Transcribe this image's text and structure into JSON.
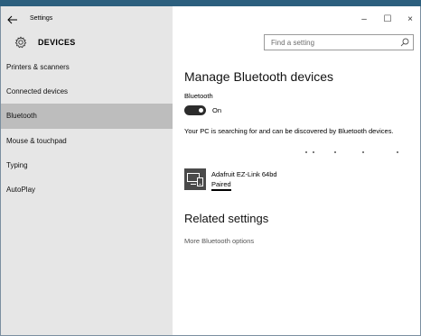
{
  "window": {
    "title": "Settings",
    "controls": {
      "minimize": "–",
      "maximize": "☐",
      "close": "×"
    }
  },
  "header": {
    "section_title": "DEVICES",
    "search_placeholder": "Find a setting"
  },
  "sidebar": {
    "items": [
      {
        "label": "Printers & scanners",
        "selected": false
      },
      {
        "label": "Connected devices",
        "selected": false
      },
      {
        "label": "Bluetooth",
        "selected": true
      },
      {
        "label": "Mouse & touchpad",
        "selected": false
      },
      {
        "label": "Typing",
        "selected": false
      },
      {
        "label": "AutoPlay",
        "selected": false
      }
    ]
  },
  "main": {
    "heading": "Manage Bluetooth devices",
    "bluetooth_label": "Bluetooth",
    "toggle_state": "On",
    "status_text": "Your PC is searching for and can be discovered by Bluetooth devices.",
    "device": {
      "name": "Adafruit EZ-Link 64bd",
      "status": "Paired"
    },
    "related_heading": "Related settings",
    "more_link": "More Bluetooth options"
  },
  "colors": {
    "accent_bar": "#2c5f7e",
    "sidebar_bg": "#e6e6e6",
    "selected_bg": "#bdbdbd",
    "toggle_on": "#2c2c2c"
  }
}
